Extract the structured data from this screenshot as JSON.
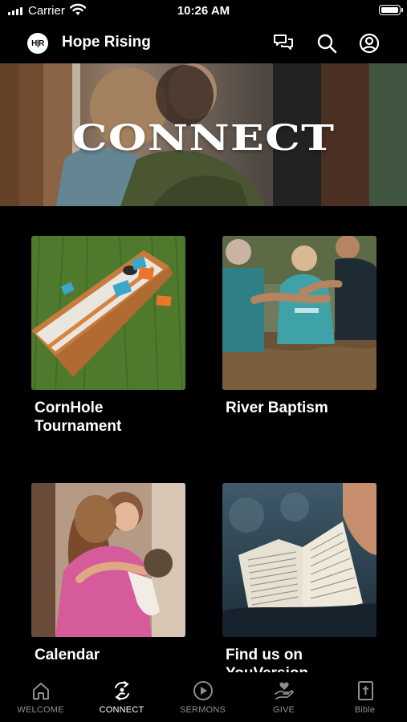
{
  "status_bar": {
    "carrier": "Carrier",
    "time": "10:26 AM"
  },
  "header": {
    "logo_text": "H|R",
    "title": "Hope Rising",
    "icons": [
      "chat-icon",
      "search-icon",
      "account-icon"
    ]
  },
  "hero": {
    "title": "CONNECT"
  },
  "cards": [
    {
      "label": "CornHole\nTournament",
      "image": "cornhole-board-photo"
    },
    {
      "label": "River Baptism",
      "image": "river-baptism-photo"
    },
    {
      "label": "Calendar",
      "image": "hugging-women-photo"
    },
    {
      "label": "Find us on\nYouVersion",
      "image": "open-bible-photo"
    }
  ],
  "tabs": [
    {
      "label": "WELCOME",
      "icon": "home-icon",
      "active": false
    },
    {
      "label": "CONNECT",
      "icon": "connect-icon",
      "active": true
    },
    {
      "label": "SERMONS",
      "icon": "play-icon",
      "active": false
    },
    {
      "label": "GIVE",
      "icon": "give-icon",
      "active": false
    },
    {
      "label": "Bible",
      "icon": "bible-icon",
      "active": false
    }
  ],
  "colors": {
    "background": "#000000",
    "active_tab": "#ffffff",
    "inactive_tab": "#8d8d8d"
  }
}
